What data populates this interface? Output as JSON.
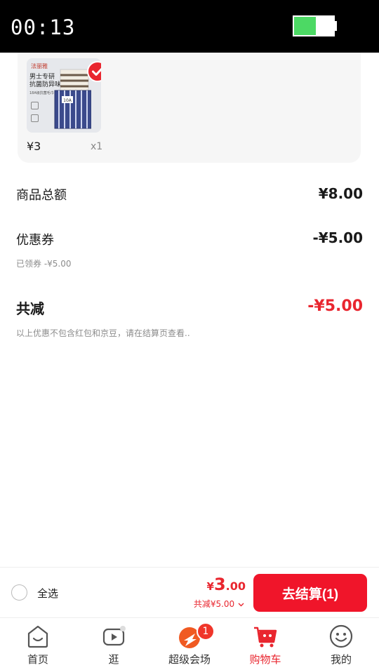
{
  "status_bar": {
    "time": "00:13",
    "battery_level": 0.55,
    "battery_color": "#4cd964"
  },
  "product": {
    "thumbnail_brand": "法丽雅",
    "thumbnail_title": "男士专研\n抗菌防异味",
    "thumbnail_subtitle": "18A级抗菌毛巾",
    "thumbnail_tag": "10A",
    "price": "¥3",
    "quantity": "x1",
    "selected": true
  },
  "summary": {
    "goods_total_label": "商品总额",
    "goods_total_value": "¥8.00",
    "coupon_label": "优惠券",
    "coupon_value": "-¥5.00",
    "coupon_note": "已领券 -¥5.00",
    "total_reduce_label": "共减",
    "total_reduce_value": "-¥5.00",
    "disclaimer": "以上优惠不包含红包和京豆，请在结算页查看.."
  },
  "checkout": {
    "select_all_label": "全选",
    "currency_symbol": "¥",
    "total_integer": "3",
    "total_decimal": ".00",
    "discount_text": "共减¥5.00",
    "checkout_button_label": "去结算(1)"
  },
  "tabs": [
    {
      "label": "首页",
      "icon": "home-icon",
      "active": false
    },
    {
      "label": "逛",
      "icon": "video-icon",
      "active": false
    },
    {
      "label": "超级会场",
      "icon": "super-venue-icon",
      "active": false,
      "badge": "1"
    },
    {
      "label": "购物车",
      "icon": "cart-icon",
      "active": true
    },
    {
      "label": "我的",
      "icon": "profile-icon",
      "active": false
    }
  ],
  "colors": {
    "accent": "#e9262f",
    "button": "#f0152a"
  }
}
